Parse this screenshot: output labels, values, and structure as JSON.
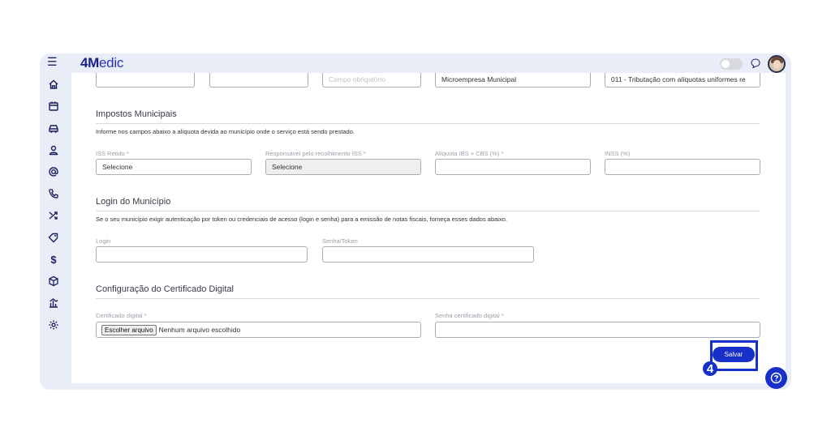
{
  "app": {
    "logo_bold": "4M",
    "logo_rest": "edic"
  },
  "top_row": {
    "field1_value": "",
    "field2_value": "",
    "field3_placeholder": "Campo obrigatório",
    "field4_value": "Microempresa Municipal",
    "field5_value": "011 - Tributação com alíquotas uniformes re"
  },
  "impostos": {
    "title": "Impostos Municipais",
    "description": "Informe nos campos abaixo a alíquota devida ao município onde o serviço está sendo prestado.",
    "iss_label": "ISS Retido *",
    "iss_value": "Selecione",
    "resp_label": "Responsável pelo recolhimento ISS *",
    "resp_value": "Selecione",
    "ibs_label": "Alíquota IBS + CBS (%) *",
    "ibs_value": "",
    "inss_label": "INSS (%)",
    "inss_value": ""
  },
  "login": {
    "title": "Login do Município",
    "description": "Se o seu município exigir autenticação por token ou credenciais de acesso (login e senha) para a emissão de notas fiscais, forneça esses dados abaixo.",
    "login_label": "Login",
    "login_value": "",
    "token_label": "Senha/Token",
    "token_value": ""
  },
  "cert": {
    "title": "Configuração do Certificado Digital",
    "file_label": "Certificado digital *",
    "file_button": "Escolher arquivo",
    "file_status": "Nenhum arquivo escolhido",
    "password_label": "Senha certificado digital *",
    "password_value": ""
  },
  "actions": {
    "save_label": "Salvar"
  },
  "annotation": {
    "step_number": "4"
  },
  "colors": {
    "accent": "#1730c9",
    "brand": "#1a1f8f",
    "frame": "#e8edf8"
  },
  "sidebar": {
    "items": [
      {
        "icon": "home-icon"
      },
      {
        "icon": "calendar-icon"
      },
      {
        "icon": "car-icon"
      },
      {
        "icon": "user-icon"
      },
      {
        "icon": "at-icon"
      },
      {
        "icon": "phone-icon"
      },
      {
        "icon": "shuffle-icon"
      },
      {
        "icon": "tag-icon"
      },
      {
        "icon": "dollar-icon"
      },
      {
        "icon": "box-icon"
      },
      {
        "icon": "chart-icon"
      },
      {
        "icon": "gear-icon"
      }
    ]
  }
}
